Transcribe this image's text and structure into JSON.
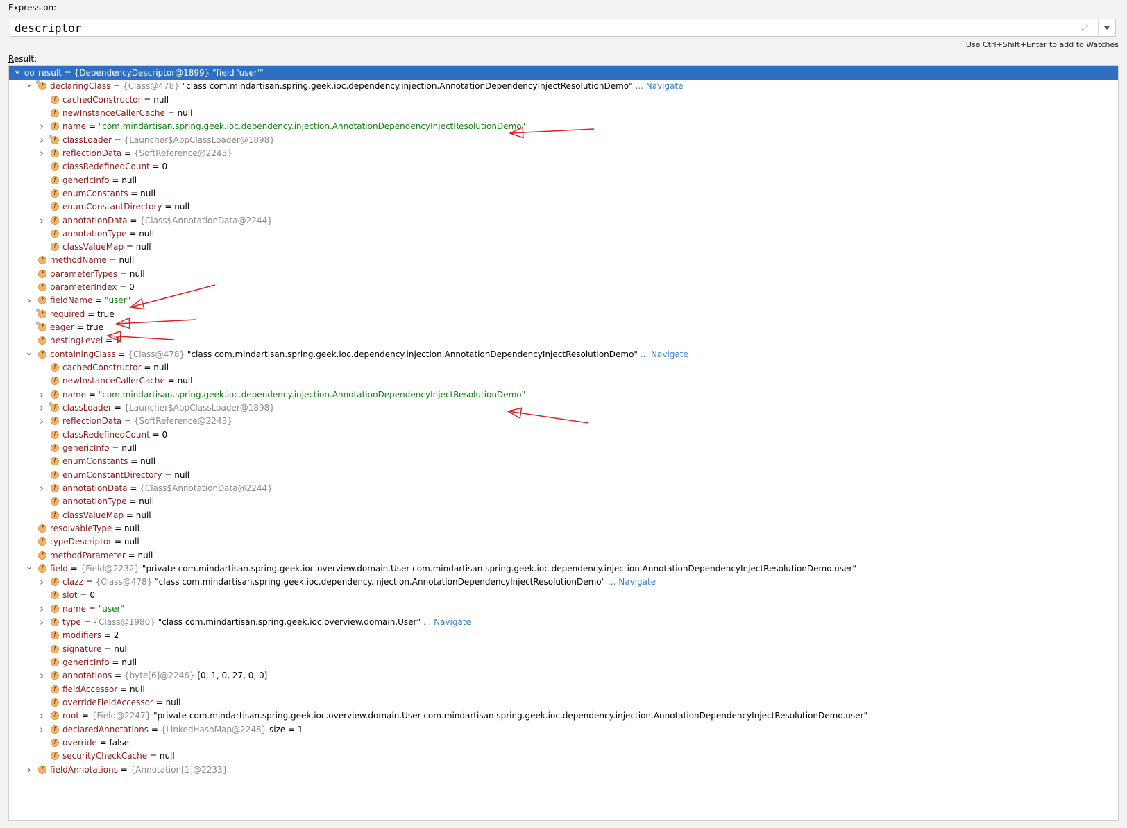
{
  "expression": {
    "label": "Expression:",
    "value": "descriptor",
    "hint": "Use Ctrl+Shift+Enter to add to Watches"
  },
  "result": {
    "label_prefix": "R",
    "label_rest": "esult:"
  },
  "tree": [
    {
      "depth": 0,
      "arrow": "down",
      "icon": "oo",
      "selected": true,
      "name": "result",
      "eq": " = ",
      "ref": "{DependencyDescriptor@1899}",
      "val": " \"field 'user'\"",
      "valType": "plain"
    },
    {
      "depth": 1,
      "arrow": "down",
      "icon": "f",
      "lock": true,
      "name": "declaringClass",
      "eq": " = ",
      "ref": "{Class@478}",
      "val": " \"class com.mindartisan.spring.geek.ioc.dependency.injection.AnnotationDependencyInjectResolutionDemo\"",
      "valType": "plain",
      "nav": " ... Navigate"
    },
    {
      "depth": 2,
      "arrow": "",
      "icon": "f",
      "name": "cachedConstructor",
      "eq": " = ",
      "val": "null",
      "valType": "plain"
    },
    {
      "depth": 2,
      "arrow": "",
      "icon": "f",
      "name": "newInstanceCallerCache",
      "eq": " = ",
      "val": "null",
      "valType": "plain"
    },
    {
      "depth": 2,
      "arrow": "right",
      "icon": "f",
      "name": "name",
      "eq": " = ",
      "val": "\"com.mindartisan.spring.geek.ioc.dependency.injection.AnnotationDependencyInjectResolutionDemo\"",
      "valType": "str"
    },
    {
      "depth": 2,
      "arrow": "right",
      "icon": "f",
      "lock": true,
      "name": "classLoader",
      "eq": " = ",
      "ref": "{Launcher$AppClassLoader@1898}",
      "valType": "plain"
    },
    {
      "depth": 2,
      "arrow": "right",
      "icon": "f",
      "name": "reflectionData",
      "eq": " = ",
      "ref": "{SoftReference@2243}",
      "valType": "plain"
    },
    {
      "depth": 2,
      "arrow": "",
      "icon": "f",
      "name": "classRedefinedCount",
      "eq": " = ",
      "val": "0",
      "valType": "plain"
    },
    {
      "depth": 2,
      "arrow": "",
      "icon": "f",
      "name": "genericInfo",
      "eq": " = ",
      "val": "null",
      "valType": "plain"
    },
    {
      "depth": 2,
      "arrow": "",
      "icon": "f",
      "name": "enumConstants",
      "eq": " = ",
      "val": "null",
      "valType": "plain"
    },
    {
      "depth": 2,
      "arrow": "",
      "icon": "f",
      "name": "enumConstantDirectory",
      "eq": " = ",
      "val": "null",
      "valType": "plain"
    },
    {
      "depth": 2,
      "arrow": "right",
      "icon": "f",
      "name": "annotationData",
      "eq": " = ",
      "ref": "{Class$AnnotationData@2244}",
      "valType": "plain"
    },
    {
      "depth": 2,
      "arrow": "",
      "icon": "f",
      "name": "annotationType",
      "eq": " = ",
      "val": "null",
      "valType": "plain"
    },
    {
      "depth": 2,
      "arrow": "",
      "icon": "f",
      "name": "classValueMap",
      "eq": " = ",
      "val": "null",
      "valType": "plain"
    },
    {
      "depth": 1,
      "arrow": "",
      "icon": "f",
      "name": "methodName",
      "eq": " = ",
      "val": "null",
      "valType": "plain"
    },
    {
      "depth": 1,
      "arrow": "",
      "icon": "f",
      "name": "parameterTypes",
      "eq": " = ",
      "val": "null",
      "valType": "plain"
    },
    {
      "depth": 1,
      "arrow": "",
      "icon": "f",
      "name": "parameterIndex",
      "eq": " = ",
      "val": "0",
      "valType": "plain"
    },
    {
      "depth": 1,
      "arrow": "right",
      "icon": "f",
      "name": "fieldName",
      "eq": " = ",
      "val": "\"user\"",
      "valType": "str"
    },
    {
      "depth": 1,
      "arrow": "",
      "icon": "f",
      "lock": true,
      "name": "required",
      "eq": " = ",
      "val": "true",
      "valType": "plain"
    },
    {
      "depth": 1,
      "arrow": "",
      "icon": "f",
      "lock": true,
      "name": "eager",
      "eq": " = ",
      "val": "true",
      "valType": "plain"
    },
    {
      "depth": 1,
      "arrow": "",
      "icon": "f",
      "name": "nestingLevel",
      "eq": " = ",
      "val": "1",
      "valType": "plain"
    },
    {
      "depth": 1,
      "arrow": "down",
      "icon": "f",
      "name": "containingClass",
      "eq": " = ",
      "ref": "{Class@478}",
      "val": " \"class com.mindartisan.spring.geek.ioc.dependency.injection.AnnotationDependencyInjectResolutionDemo\"",
      "valType": "plain",
      "nav": " ... Navigate"
    },
    {
      "depth": 2,
      "arrow": "",
      "icon": "f",
      "name": "cachedConstructor",
      "eq": " = ",
      "val": "null",
      "valType": "plain"
    },
    {
      "depth": 2,
      "arrow": "",
      "icon": "f",
      "name": "newInstanceCallerCache",
      "eq": " = ",
      "val": "null",
      "valType": "plain"
    },
    {
      "depth": 2,
      "arrow": "right",
      "icon": "f",
      "name": "name",
      "eq": " = ",
      "val": "\"com.mindartisan.spring.geek.ioc.dependency.injection.AnnotationDependencyInjectResolutionDemo\"",
      "valType": "str"
    },
    {
      "depth": 2,
      "arrow": "right",
      "icon": "f",
      "lock": true,
      "name": "classLoader",
      "eq": " = ",
      "ref": "{Launcher$AppClassLoader@1898}",
      "valType": "plain"
    },
    {
      "depth": 2,
      "arrow": "right",
      "icon": "f",
      "name": "reflectionData",
      "eq": " = ",
      "ref": "{SoftReference@2243}",
      "valType": "plain"
    },
    {
      "depth": 2,
      "arrow": "",
      "icon": "f",
      "name": "classRedefinedCount",
      "eq": " = ",
      "val": "0",
      "valType": "plain"
    },
    {
      "depth": 2,
      "arrow": "",
      "icon": "f",
      "name": "genericInfo",
      "eq": " = ",
      "val": "null",
      "valType": "plain"
    },
    {
      "depth": 2,
      "arrow": "",
      "icon": "f",
      "name": "enumConstants",
      "eq": " = ",
      "val": "null",
      "valType": "plain"
    },
    {
      "depth": 2,
      "arrow": "",
      "icon": "f",
      "name": "enumConstantDirectory",
      "eq": " = ",
      "val": "null",
      "valType": "plain"
    },
    {
      "depth": 2,
      "arrow": "right",
      "icon": "f",
      "name": "annotationData",
      "eq": " = ",
      "ref": "{Class$AnnotationData@2244}",
      "valType": "plain"
    },
    {
      "depth": 2,
      "arrow": "",
      "icon": "f",
      "name": "annotationType",
      "eq": " = ",
      "val": "null",
      "valType": "plain"
    },
    {
      "depth": 2,
      "arrow": "",
      "icon": "f",
      "name": "classValueMap",
      "eq": " = ",
      "val": "null",
      "valType": "plain"
    },
    {
      "depth": 1,
      "arrow": "",
      "icon": "f",
      "name": "resolvableType",
      "eq": " = ",
      "val": "null",
      "valType": "plain"
    },
    {
      "depth": 1,
      "arrow": "",
      "icon": "f",
      "name": "typeDescriptor",
      "eq": " = ",
      "val": "null",
      "valType": "plain"
    },
    {
      "depth": 1,
      "arrow": "",
      "icon": "f",
      "name": "methodParameter",
      "eq": " = ",
      "val": "null",
      "valType": "plain"
    },
    {
      "depth": 1,
      "arrow": "down",
      "icon": "f",
      "name": "field",
      "eq": " = ",
      "ref": "{Field@2232}",
      "val": " \"private com.mindartisan.spring.geek.ioc.overview.domain.User com.mindartisan.spring.geek.ioc.dependency.injection.AnnotationDependencyInjectResolutionDemo.user\"",
      "valType": "plain"
    },
    {
      "depth": 2,
      "arrow": "right",
      "icon": "f",
      "name": "clazz",
      "eq": " = ",
      "ref": "{Class@478}",
      "val": " \"class com.mindartisan.spring.geek.ioc.dependency.injection.AnnotationDependencyInjectResolutionDemo\"",
      "valType": "plain",
      "nav": " ... Navigate"
    },
    {
      "depth": 2,
      "arrow": "",
      "icon": "f",
      "name": "slot",
      "eq": " = ",
      "val": "0",
      "valType": "plain"
    },
    {
      "depth": 2,
      "arrow": "right",
      "icon": "f",
      "name": "name",
      "eq": " = ",
      "val": "\"user\"",
      "valType": "str"
    },
    {
      "depth": 2,
      "arrow": "right",
      "icon": "f",
      "name": "type",
      "eq": " = ",
      "ref": "{Class@1980}",
      "val": " \"class com.mindartisan.spring.geek.ioc.overview.domain.User\"",
      "valType": "plain",
      "nav": " ... Navigate"
    },
    {
      "depth": 2,
      "arrow": "",
      "icon": "f",
      "name": "modifiers",
      "eq": " = ",
      "val": "2",
      "valType": "plain"
    },
    {
      "depth": 2,
      "arrow": "",
      "icon": "f",
      "name": "signature",
      "eq": " = ",
      "val": "null",
      "valType": "plain"
    },
    {
      "depth": 2,
      "arrow": "",
      "icon": "f",
      "name": "genericInfo",
      "eq": " = ",
      "val": "null",
      "valType": "plain"
    },
    {
      "depth": 2,
      "arrow": "right",
      "icon": "f",
      "name": "annotations",
      "eq": " = ",
      "ref": "{byte[6]@2246}",
      "val": " [0, 1, 0, 27, 0, 0]",
      "valType": "plain"
    },
    {
      "depth": 2,
      "arrow": "",
      "icon": "f",
      "name": "fieldAccessor",
      "eq": " = ",
      "val": "null",
      "valType": "plain"
    },
    {
      "depth": 2,
      "arrow": "",
      "icon": "f",
      "name": "overrideFieldAccessor",
      "eq": " = ",
      "val": "null",
      "valType": "plain"
    },
    {
      "depth": 2,
      "arrow": "right",
      "icon": "f",
      "name": "root",
      "eq": " = ",
      "ref": "{Field@2247}",
      "val": " \"private com.mindartisan.spring.geek.ioc.overview.domain.User com.mindartisan.spring.geek.ioc.dependency.injection.AnnotationDependencyInjectResolutionDemo.user\"",
      "valType": "plain"
    },
    {
      "depth": 2,
      "arrow": "right",
      "icon": "f",
      "name": "declaredAnnotations",
      "eq": " = ",
      "ref": "{LinkedHashMap@2248}",
      "val": "  size = 1",
      "valType": "plain"
    },
    {
      "depth": 2,
      "arrow": "",
      "icon": "f",
      "name": "override",
      "eq": " = ",
      "val": "false",
      "valType": "plain"
    },
    {
      "depth": 2,
      "arrow": "",
      "icon": "f",
      "name": "securityCheckCache",
      "eq": " = ",
      "val": "null",
      "valType": "plain"
    },
    {
      "depth": 1,
      "arrow": "right",
      "icon": "f",
      "name": "fieldAnnotations",
      "eq": " = ",
      "ref": "{Annotation[1]@2233}",
      "valType": "plain"
    }
  ],
  "icons": {
    "expand": "expand-icon",
    "dropdown": "chevron-down-icon",
    "field": "field-icon",
    "watch": "glasses-icon"
  },
  "colors": {
    "selection": "#2f6fc2",
    "field_name": "#8b1a1a",
    "string_value": "#127f12",
    "reference": "#8a8a8a",
    "navigate": "#3d7ecb",
    "annotation_arrow": "#e02020"
  }
}
